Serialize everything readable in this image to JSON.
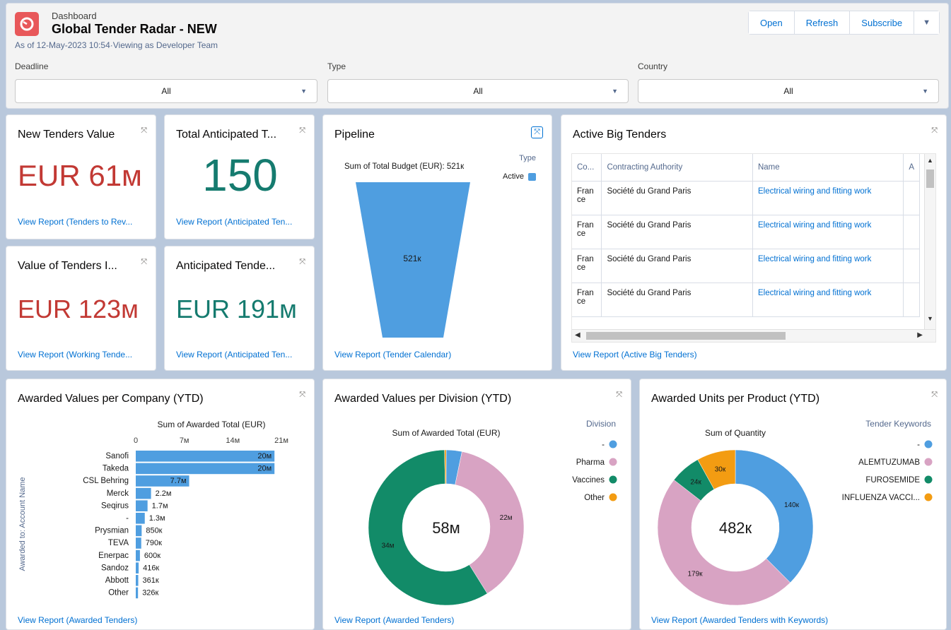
{
  "header": {
    "breadcrumb": "Dashboard",
    "title": "Global Tender Radar - NEW",
    "as_of": "As of 12-May-2023 10:54·Viewing as Developer Team",
    "buttons": {
      "open": "Open",
      "refresh": "Refresh",
      "subscribe": "Subscribe"
    }
  },
  "filters": [
    {
      "label": "Deadline",
      "value": "All"
    },
    {
      "label": "Type",
      "value": "All"
    },
    {
      "label": "Country",
      "value": "All"
    }
  ],
  "metrics": {
    "new_tenders": {
      "title": "New Tenders Value",
      "value": "EUR 61м",
      "link": "View Report (Tenders to Rev..."
    },
    "total_anticipated": {
      "title": "Total Anticipated T...",
      "value": "150",
      "link": "View Report (Anticipated Ten..."
    },
    "value_of_tenders": {
      "title": "Value of Tenders I...",
      "value": "EUR 123м",
      "link": "View Report (Working Tende..."
    },
    "anticipated_value": {
      "title": "Anticipated Tende...",
      "value": "EUR 191м",
      "link": "View Report (Anticipated Ten..."
    }
  },
  "pipeline": {
    "title": "Pipeline",
    "subtitle": "Sum of Total Budget (EUR): 521к",
    "legend_title": "Type",
    "legend_item": "Active",
    "bar_label": "521к",
    "link": "View Report (Tender Calendar)"
  },
  "big_tenders": {
    "title": "Active Big Tenders",
    "columns": [
      "Co...",
      "Contracting Authority",
      "Name",
      "A"
    ],
    "rows": [
      {
        "country": "France",
        "authority": "Société du Grand Paris",
        "name": "Electrical wiring and fitting work"
      },
      {
        "country": "France",
        "authority": "Société du Grand Paris",
        "name": "Electrical wiring and fitting work"
      },
      {
        "country": "France",
        "authority": "Société du Grand Paris",
        "name": "Electrical wiring and fitting work"
      },
      {
        "country": "France",
        "authority": "Société du Grand Paris",
        "name": "Electrical wiring and fitting work"
      }
    ],
    "link": "View Report (Active Big Tenders)"
  },
  "company_card": {
    "title": "Awarded Values per Company (YTD)",
    "link": "View Report (Awarded Tenders)"
  },
  "division_card": {
    "title": "Awarded Values per Division (YTD)",
    "link": "View Report (Awarded Tenders)"
  },
  "product_card": {
    "title": "Awarded Units per Product (YTD)",
    "link": "View Report (Awarded Tenders with Keywords)"
  },
  "chart_data": [
    {
      "type": "bar",
      "orientation": "horizontal",
      "title": "Sum of Awarded Total (EUR)",
      "ylabel": "Awarded to: Account Name",
      "xticks": [
        "0",
        "7м",
        "14м",
        "21м"
      ],
      "xlim": [
        0,
        21000000
      ],
      "categories": [
        "Sanofi",
        "Takeda",
        "CSL Behring",
        "Merck",
        "Seqirus",
        "-",
        "Prysmian",
        "TEVA",
        "Enerpac",
        "Sandoz",
        "Abbott",
        "Other"
      ],
      "values": [
        20000000,
        20000000,
        7700000,
        2200000,
        1700000,
        1300000,
        850000,
        790000,
        600000,
        416000,
        361000,
        326000
      ],
      "labels": [
        "20м",
        "20м",
        "7.7м",
        "2.2м",
        "1.7м",
        "1.3м",
        "850к",
        "790к",
        "600к",
        "416к",
        "361к",
        "326к"
      ],
      "color": "#4f9ee0"
    },
    {
      "type": "pie",
      "variant": "donut",
      "title": "Sum of Awarded Total (EUR)",
      "center_label": "58м",
      "legend_title": "Division",
      "legend": [
        "-",
        "Pharma",
        "Vaccines",
        "Other"
      ],
      "slices": [
        {
          "name": "-",
          "value": 1.9,
          "color": "#4f9ee0",
          "label": ""
        },
        {
          "name": "Pharma",
          "value": 22,
          "color": "#d8a3c3",
          "label": "22м"
        },
        {
          "name": "Vaccines",
          "value": 34,
          "color": "#128b68",
          "label": "34м"
        },
        {
          "name": "Other",
          "value": 0.2,
          "color": "#f39c12",
          "label": ""
        }
      ]
    },
    {
      "type": "pie",
      "variant": "donut",
      "title": "Sum of Quantity",
      "center_label": "482к",
      "legend_title": "Tender Keywords",
      "legend": [
        "-",
        "ALEMTUZUMAB",
        "FUROSEMIDE",
        "INFLUENZA VACCI..."
      ],
      "slices": [
        {
          "name": "-",
          "value": 140,
          "color": "#4f9ee0",
          "label": "140к"
        },
        {
          "name": "ALEMTUZUMAB",
          "value": 179,
          "color": "#d8a3c3",
          "label": "179к"
        },
        {
          "name": "FUROSEMIDE",
          "value": 24,
          "color": "#128b68",
          "label": "24к"
        },
        {
          "name": "INFLUENZA VACCI...",
          "value": 30,
          "color": "#f39c12",
          "label": "30к"
        }
      ]
    }
  ]
}
